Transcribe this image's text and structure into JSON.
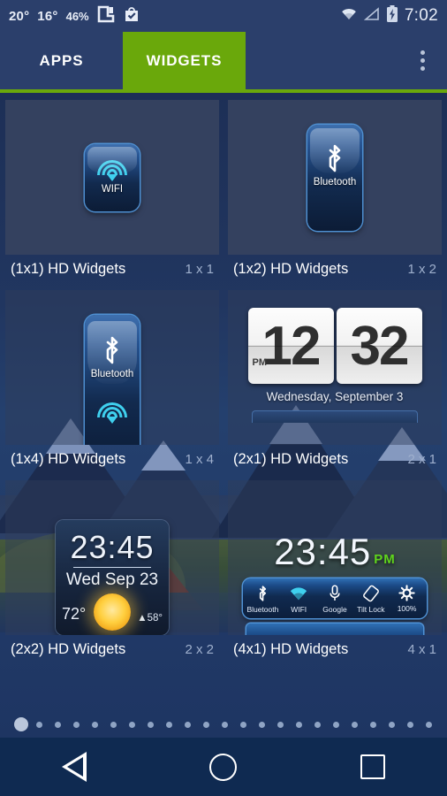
{
  "statusbar": {
    "temp_current": "20°",
    "temp_secondary": "16°",
    "humidity": "46%",
    "clock": "7:02",
    "icons": [
      "weather-widget-icon",
      "shopping-bag-check-icon",
      "wifi-icon",
      "signal-icon",
      "battery-charging-icon"
    ]
  },
  "tabs": {
    "apps": "APPS",
    "widgets": "WIDGETS",
    "active": "WIDGETS"
  },
  "colors": {
    "accent_green": "#6aa80b",
    "status_bar": "#2b3f6b",
    "page_bg": "#1d3360",
    "cell_bg": "#364360",
    "caption": "#ffffff",
    "size_label": "#9fb0cd",
    "toggle_cyan": "#3fd0ee",
    "pm_green": "#5fd41c"
  },
  "widgets": [
    {
      "name": "(1x1) HD Widgets",
      "size": "1 x 1",
      "preview_type": "toggle-1x1",
      "toggle_label": "WIFI",
      "icon": "wifi-icon"
    },
    {
      "name": "(1x2) HD Widgets",
      "size": "1 x 2",
      "preview_type": "toggle-1x2",
      "toggle_label": "Bluetooth",
      "icon": "bluetooth-icon"
    },
    {
      "name": "(1x4) HD Widgets",
      "size": "1 x 4",
      "preview_type": "toggle-1x4",
      "toggle_label": "Bluetooth",
      "icon": "bluetooth-icon",
      "icon_secondary": "wifi-icon"
    },
    {
      "name": "(2x1) HD Widgets",
      "size": "2 x 1",
      "preview_type": "flip-clock",
      "hours": "12",
      "minutes": "32",
      "meridiem": "PM",
      "date": "Wednesday, September 3"
    },
    {
      "name": "(2x2) HD Widgets",
      "size": "2 x 2",
      "preview_type": "clock-weather",
      "time": "23:45",
      "date": "Wed Sep 23",
      "temp": "72°",
      "high": "▲58°",
      "weather_icon": "sun-icon"
    },
    {
      "name": "(4x1) HD Widgets",
      "size": "4 x 1",
      "preview_type": "clock-toggles",
      "time": "23:45",
      "meridiem": "PM",
      "toggles": [
        {
          "label": "Bluetooth",
          "icon": "bluetooth-icon"
        },
        {
          "label": "WIFI",
          "icon": "wifi-icon"
        },
        {
          "label": "Google",
          "icon": "microphone-icon"
        },
        {
          "label": "Tilt Lock",
          "icon": "rotation-lock-icon"
        },
        {
          "label": "100%",
          "icon": "gear-icon"
        }
      ]
    }
  ],
  "pager": {
    "total_pages": 23,
    "active_page": 1
  },
  "navbar": {
    "back": "Back",
    "home": "Home",
    "recents": "Recent apps"
  }
}
